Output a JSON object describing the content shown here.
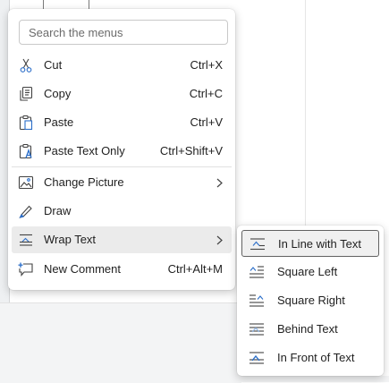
{
  "search": {
    "placeholder": "Search the menus",
    "value": ""
  },
  "menu": {
    "items": [
      {
        "label": "Cut",
        "shortcut": "Ctrl+X",
        "icon": "scissors-icon"
      },
      {
        "label": "Copy",
        "shortcut": "Ctrl+C",
        "icon": "copy-icon"
      },
      {
        "label": "Paste",
        "shortcut": "Ctrl+V",
        "icon": "paste-icon"
      },
      {
        "label": "Paste Text Only",
        "shortcut": "Ctrl+Shift+V",
        "icon": "paste-text-only-icon"
      },
      {
        "label": "Change Picture",
        "shortcut": "",
        "icon": "change-picture-icon",
        "submenu": true
      },
      {
        "label": "Draw",
        "shortcut": "",
        "icon": "draw-pen-icon"
      },
      {
        "label": "Wrap Text",
        "shortcut": "",
        "icon": "wrap-text-icon",
        "submenu": true,
        "highlighted": true
      },
      {
        "label": "New Comment",
        "shortcut": "Ctrl+Alt+M",
        "icon": "new-comment-icon"
      }
    ]
  },
  "wrap_submenu": {
    "items": [
      {
        "label": "In Line with Text",
        "icon": "in-line-with-text-icon",
        "focused": true
      },
      {
        "label": "Square Left",
        "icon": "square-left-icon"
      },
      {
        "label": "Square Right",
        "icon": "square-right-icon"
      },
      {
        "label": "Behind Text",
        "icon": "behind-text-icon"
      },
      {
        "label": "In Front of Text",
        "icon": "in-front-of-text-icon"
      }
    ]
  },
  "colors": {
    "icon_blue": "#2b6ec9",
    "icon_stroke": "#424242",
    "hover_bg": "#ebebeb"
  }
}
